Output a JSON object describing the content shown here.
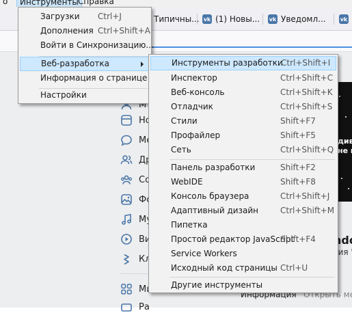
{
  "menubar": {
    "fragment": "о (L)",
    "tools": "Инструменты",
    "help": "Справка"
  },
  "tabs": [
    {
      "title": "Типичны...",
      "icon": "vk-icon"
    },
    {
      "title": "(1) Новы...",
      "icon": "vk-icon"
    },
    {
      "title": "Уведомл...",
      "icon": "vk-icon"
    },
    {
      "title": "",
      "icon": "vk-icon"
    }
  ],
  "tools_menu": {
    "items": [
      {
        "label": "Загрузки",
        "shortcut": "Ctrl+J"
      },
      {
        "label": "Дополнения",
        "shortcut": "Ctrl+Shift+A"
      },
      {
        "label": "Войти в Синхронизацию...",
        "shortcut": ""
      },
      {
        "label": "Веб-разработка",
        "shortcut": "",
        "submenu": true,
        "highlighted": true
      },
      {
        "label": "Информация о странице",
        "shortcut": ""
      },
      {
        "label": "Настройки",
        "shortcut": ""
      }
    ]
  },
  "webdev_menu": {
    "items": [
      {
        "label": "Инструменты разработки",
        "shortcut": "Ctrl+Shift+I",
        "highlighted": true
      },
      {
        "label": "Инспектор",
        "shortcut": "Ctrl+Shift+C"
      },
      {
        "label": "Веб-консоль",
        "shortcut": "Ctrl+Shift+K"
      },
      {
        "label": "Отладчик",
        "shortcut": "Ctrl+Shift+S"
      },
      {
        "label": "Стили",
        "shortcut": "Shift+F7"
      },
      {
        "label": "Профайлер",
        "shortcut": "Shift+F5"
      },
      {
        "label": "Сеть",
        "shortcut": "Ctrl+Shift+Q"
      },
      {
        "label": "Панель разработки",
        "shortcut": "Shift+F2"
      },
      {
        "label": "WebIDE",
        "shortcut": "Shift+F8"
      },
      {
        "label": "Консоль браузера",
        "shortcut": "Ctrl+Shift+J"
      },
      {
        "label": "Адаптивный дизайн",
        "shortcut": "Ctrl+Shift+M"
      },
      {
        "label": "Пипетка",
        "shortcut": ""
      },
      {
        "label": "Простой редактор JavaScript",
        "shortcut": "Shift+F4"
      },
      {
        "label": "Service Workers",
        "shortcut": ""
      },
      {
        "label": "Исходный код страницы",
        "shortcut": "Ctrl+U"
      },
      {
        "label": "Другие инструменты",
        "shortcut": ""
      }
    ]
  },
  "sidebar": {
    "items": [
      {
        "label": "М",
        "icon": "user-icon"
      },
      {
        "label": "Но",
        "icon": "news-icon"
      },
      {
        "label": "Ме",
        "icon": "messages-icon"
      },
      {
        "label": "Др",
        "icon": "friends-icon"
      },
      {
        "label": "Со",
        "icon": "communities-icon"
      },
      {
        "label": "Фо",
        "icon": "photos-icon"
      },
      {
        "label": "Му",
        "icon": "music-icon"
      },
      {
        "label": "Ви",
        "icon": "video-icon"
      },
      {
        "label": "Кл",
        "icon": "clips-icon"
      },
      {
        "label": "Ми",
        "icon": "mini-apps-icon"
      },
      {
        "label": "Ра",
        "icon": "work-icon"
      }
    ]
  },
  "banner": {
    "line1": "дивн",
    "line2": "не нед"
  },
  "promo": {
    "title": "ndo",
    "subtitle": "сия '"
  },
  "info_bar": {
    "tab": "Информация",
    "open": "Открыть мен"
  },
  "colors": {
    "highlight": "#cde8ff",
    "highlight_border": "#99d1ff",
    "vk_blue": "#4a76a8",
    "menu_bg": "#f2f2f2"
  }
}
